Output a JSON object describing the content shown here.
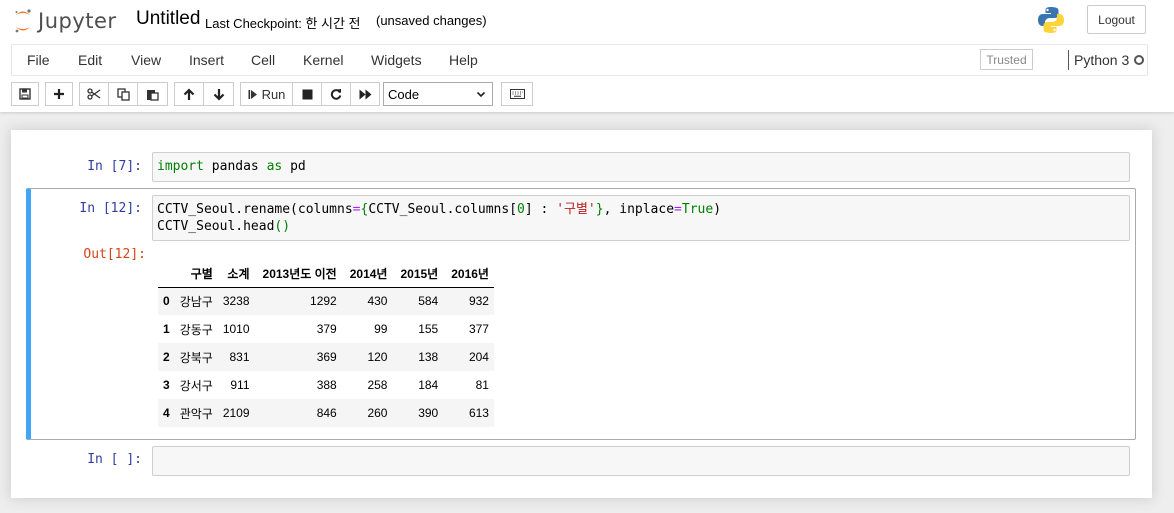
{
  "header": {
    "logo_text": "Jupyter",
    "notebook_name": "Untitled",
    "checkpoint": "Last Checkpoint: 한 시간 전",
    "autosave": "(unsaved changes)",
    "logout_label": "Logout"
  },
  "menubar": {
    "items": [
      "File",
      "Edit",
      "View",
      "Insert",
      "Cell",
      "Kernel",
      "Widgets",
      "Help"
    ],
    "trusted_label": "Trusted",
    "kernel_name": "Python 3"
  },
  "toolbar": {
    "run_label": "Run",
    "cell_type": "Code",
    "icons": [
      "save-icon",
      "plus-icon",
      "cut-icon",
      "copy-icon",
      "paste-icon",
      "arrow-up-icon",
      "arrow-down-icon",
      "step-forward-icon",
      "stop-icon",
      "restart-icon",
      "fast-forward-icon",
      "keyboard-icon"
    ]
  },
  "cells": [
    {
      "prompt": "In [7]:",
      "code_lines": [
        "import pandas as pd"
      ]
    },
    {
      "prompt": "In [12]:",
      "code_lines": [
        "CCTV_Seoul.rename(columns={CCTV_Seoul.columns[0] : '구별'}, inplace=True)",
        "CCTV_Seoul.head()"
      ],
      "out_prompt": "Out[12]:",
      "output_table": {
        "columns": [
          "",
          "구별",
          "소계",
          "2013년도 이전",
          "2014년",
          "2015년",
          "2016년"
        ],
        "rows": [
          [
            "0",
            "강남구",
            "3238",
            "1292",
            "430",
            "584",
            "932"
          ],
          [
            "1",
            "강동구",
            "1010",
            "379",
            "99",
            "155",
            "377"
          ],
          [
            "2",
            "강북구",
            "831",
            "369",
            "120",
            "138",
            "204"
          ],
          [
            "3",
            "강서구",
            "911",
            "388",
            "258",
            "184",
            "81"
          ],
          [
            "4",
            "관악구",
            "2109",
            "846",
            "260",
            "390",
            "613"
          ]
        ]
      }
    },
    {
      "prompt": "In [ ]:",
      "code_lines": [
        ""
      ]
    }
  ],
  "colors": {
    "selected_border": "#42a5f5",
    "in_prompt": "#303f9f",
    "out_prompt": "#d84315",
    "keyword": "#008000",
    "string": "#ba2121"
  }
}
